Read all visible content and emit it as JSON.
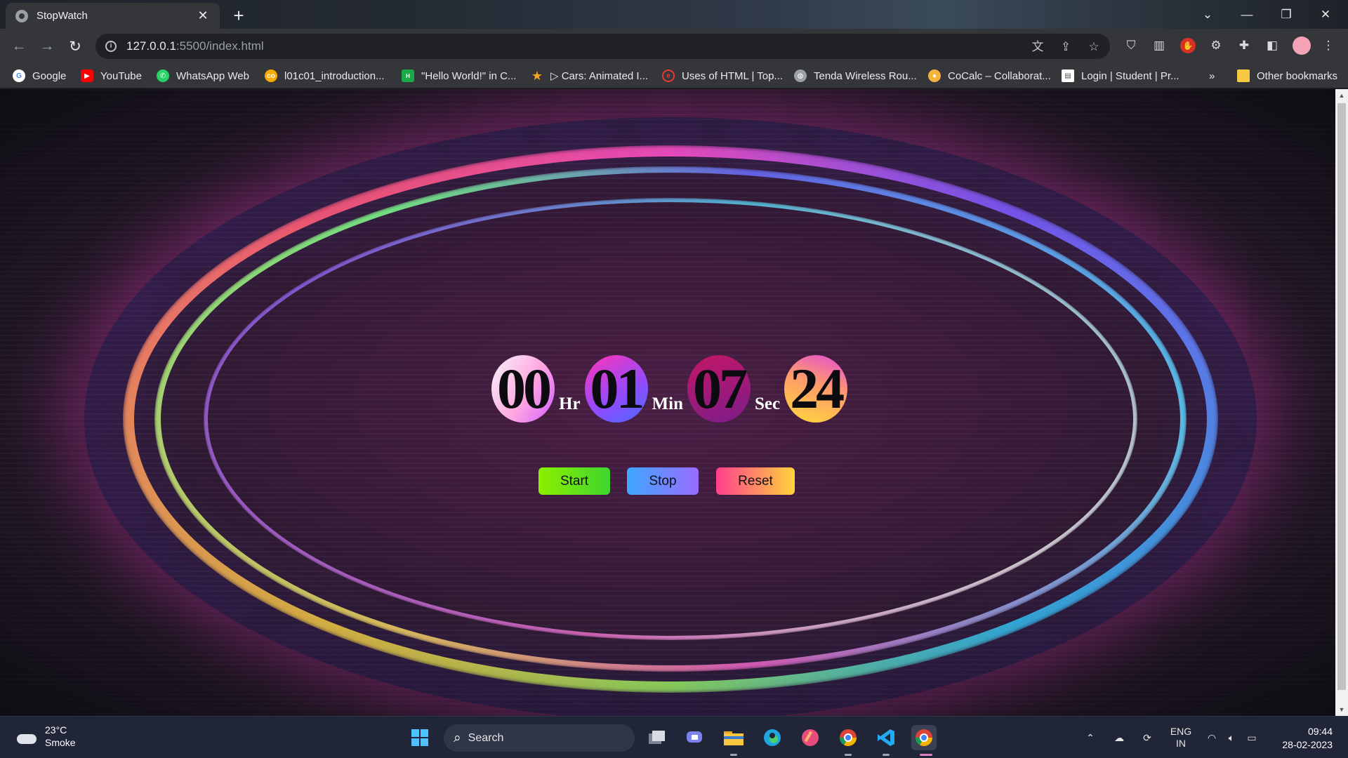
{
  "browser": {
    "tab_title": "StopWatch",
    "tab_close": "✕",
    "new_tab": "+",
    "url_host": "127.0.0.1",
    "url_path": ":5500/index.html",
    "bookmarks": [
      {
        "label": "Google",
        "icon": "google-icon",
        "color": "#ffffff"
      },
      {
        "label": "YouTube",
        "icon": "youtube-icon",
        "color": "#ff0000"
      },
      {
        "label": "WhatsApp Web",
        "icon": "whatsapp-icon",
        "color": "#25d366"
      },
      {
        "label": "l01c01_introduction...",
        "icon": "colab-icon",
        "color": "#f9ab00"
      },
      {
        "label": "\"Hello World!\" in C...",
        "icon": "hackerrank-icon",
        "color": "#1ba94c"
      },
      {
        "label": "▷ Cars: Animated I...",
        "icon": "star-icon",
        "color": "#f5a623"
      },
      {
        "label": "Uses of HTML | Top...",
        "icon": "edureka-icon",
        "color": "#e53935"
      },
      {
        "label": "Tenda Wireless Rou...",
        "icon": "globe-icon",
        "color": "#9aa0a6"
      },
      {
        "label": "CoCalc – Collaborat...",
        "icon": "cocalc-icon",
        "color": "#f3b33d"
      },
      {
        "label": "Login | Student | Pr...",
        "icon": "page-icon",
        "color": "#ffffff"
      }
    ],
    "more_bookmarks": "»",
    "other_bookmarks": "Other bookmarks"
  },
  "stopwatch": {
    "hours": "00",
    "hours_unit": "Hr",
    "minutes": "01",
    "minutes_unit": "Min",
    "seconds": "07",
    "seconds_unit": "Sec",
    "centiseconds": "24",
    "start_label": "Start",
    "stop_label": "Stop",
    "reset_label": "Reset"
  },
  "taskbar": {
    "temperature": "23°C",
    "weather": "Smoke",
    "search_label": "Search",
    "language_top": "ENG",
    "language_bottom": "IN",
    "time": "09:44",
    "date": "28-02-2023"
  }
}
